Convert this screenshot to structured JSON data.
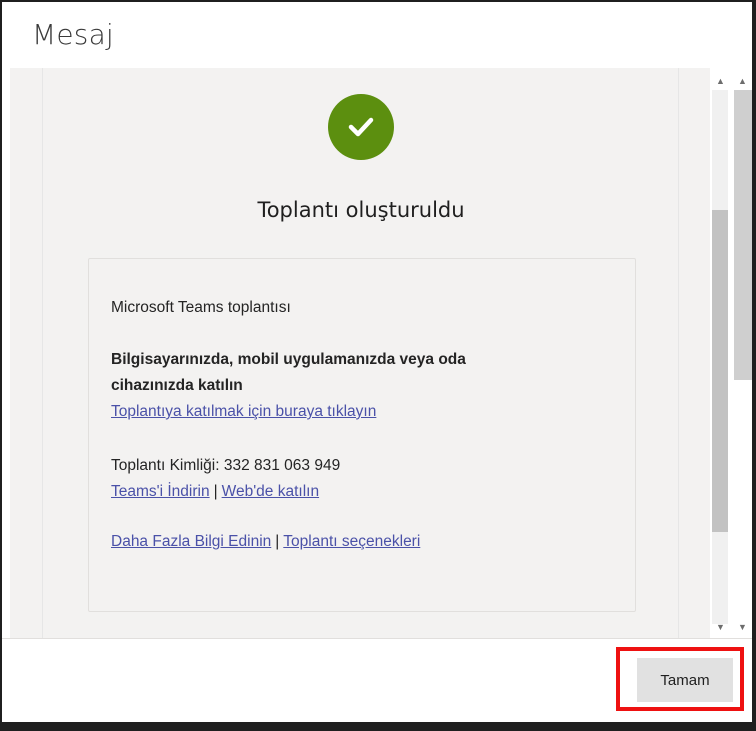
{
  "dialog": {
    "title": "Mesaj"
  },
  "content": {
    "heading": "Toplantı oluşturuldu",
    "meeting": {
      "header": "Microsoft Teams toplantısı",
      "join_prompt_line1": "Bilgisayarınızda, mobil uygulamanızda veya oda",
      "join_prompt_line2": "cihazınızda katılın",
      "join_link": "Toplantıya katılmak için buraya tıklayın",
      "meeting_id": "Toplantı Kimliği: 332 831 063 949",
      "download_teams": "Teams'i İndirin",
      "join_web": "Web'de katılın",
      "more_info": "Daha Fazla Bilgi Edinin",
      "meeting_options": "Toplantı seçenekleri",
      "separator": "|"
    }
  },
  "footer": {
    "ok_label": "Tamam"
  },
  "colors": {
    "success": "#5c8f0f",
    "link": "#4a51a8",
    "highlight": "#ee1111"
  },
  "icons": {
    "status": "check-circle-icon"
  }
}
